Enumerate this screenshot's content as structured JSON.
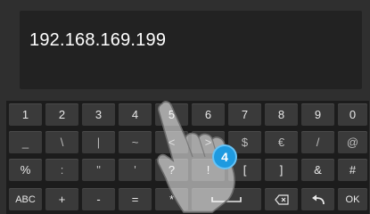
{
  "display": {
    "value": "192.168.169.199"
  },
  "keyboard": {
    "row1": [
      "1",
      "2",
      "3",
      "4",
      "5",
      "6",
      "7",
      "8",
      "9",
      "0"
    ],
    "row2": [
      "_",
      "\\",
      "|",
      "~",
      "<",
      ">",
      "$",
      "€",
      "/",
      "@"
    ],
    "row3": [
      "%",
      ":",
      "\"",
      "'",
      "?",
      "!",
      "[",
      "]",
      "&",
      "#"
    ],
    "row4": {
      "abc": "ABC",
      "plus": "+",
      "minus": "-",
      "equals": "=",
      "asterisk": "*",
      "ok": "OK",
      "space_icon": "space-bar-icon",
      "backspace_icon": "backspace-icon",
      "enter_icon": "return-arrow-icon"
    }
  },
  "overlay": {
    "step_badge": "4",
    "hand_icon": "tapping-hand-icon"
  },
  "colors": {
    "background": "#2f2f2f",
    "display": "#222222",
    "key": "#3a3a3a",
    "badge": "#1e9ae0"
  }
}
